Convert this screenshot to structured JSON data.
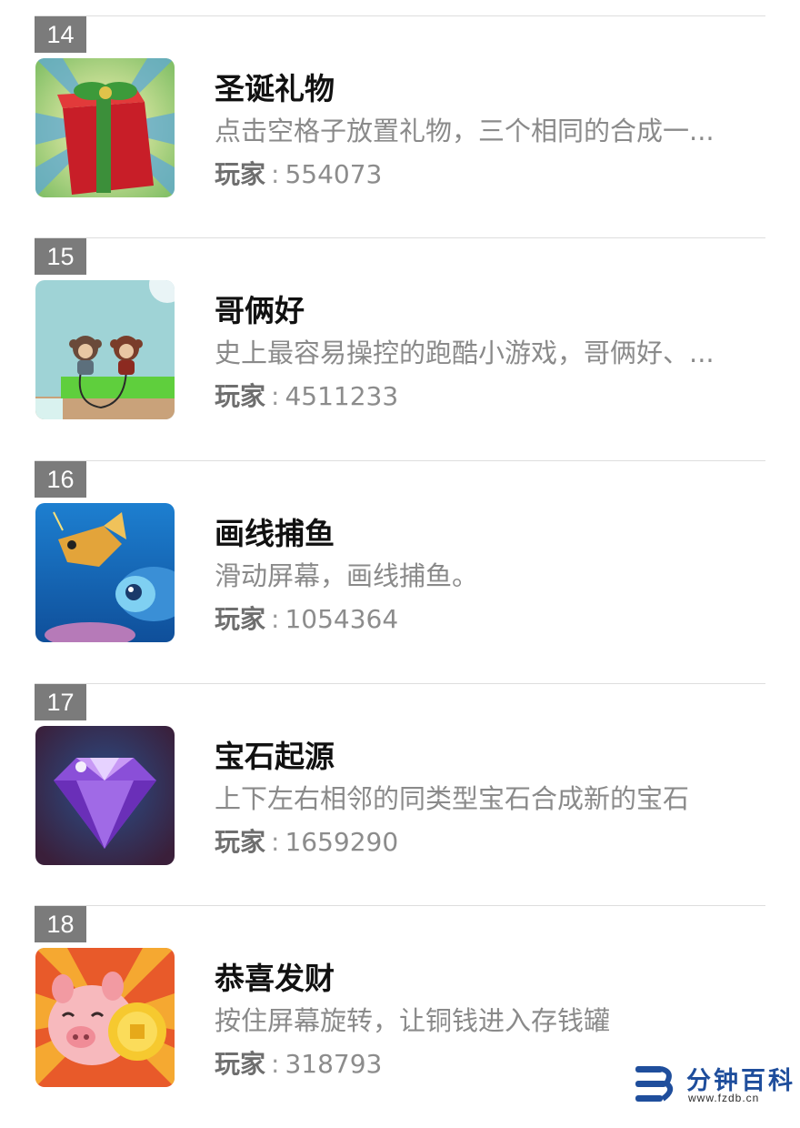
{
  "games": [
    {
      "rank": "14",
      "title": "圣诞礼物",
      "description": "点击空格子放置礼物，三个相同的合成一...",
      "players_label": "玩家",
      "players_sep": ":",
      "players": "554073",
      "icon": "christmas-gift-icon"
    },
    {
      "rank": "15",
      "title": "哥俩好",
      "description": "史上最容易操控的跑酷小游戏，哥俩好、...",
      "players_label": "玩家",
      "players_sep": ":",
      "players": "4511233",
      "icon": "monkey-brothers-icon"
    },
    {
      "rank": "16",
      "title": "画线捕鱼",
      "description": "滑动屏幕，画线捕鱼。",
      "players_label": "玩家",
      "players_sep": ":",
      "players": "1054364",
      "icon": "fish-icon"
    },
    {
      "rank": "17",
      "title": "宝石起源",
      "description": "上下左右相邻的同类型宝石合成新的宝石",
      "players_label": "玩家",
      "players_sep": ":",
      "players": "1659290",
      "icon": "gem-icon"
    },
    {
      "rank": "18",
      "title": "恭喜发财",
      "description": "按住屏幕旋转，让铜钱进入存钱罐",
      "players_label": "玩家",
      "players_sep": ":",
      "players": "318793",
      "icon": "piggy-coin-icon"
    }
  ],
  "watermark": {
    "brand": "分钟百科",
    "url": "www.fzdb.cn",
    "icon": "fzdb-logo-icon"
  },
  "colors": {
    "rank_badge": "#7b7b7b",
    "divider": "#dedede",
    "title": "#111111",
    "description": "#8a8a8a",
    "watermark": "#1f4e9c"
  }
}
